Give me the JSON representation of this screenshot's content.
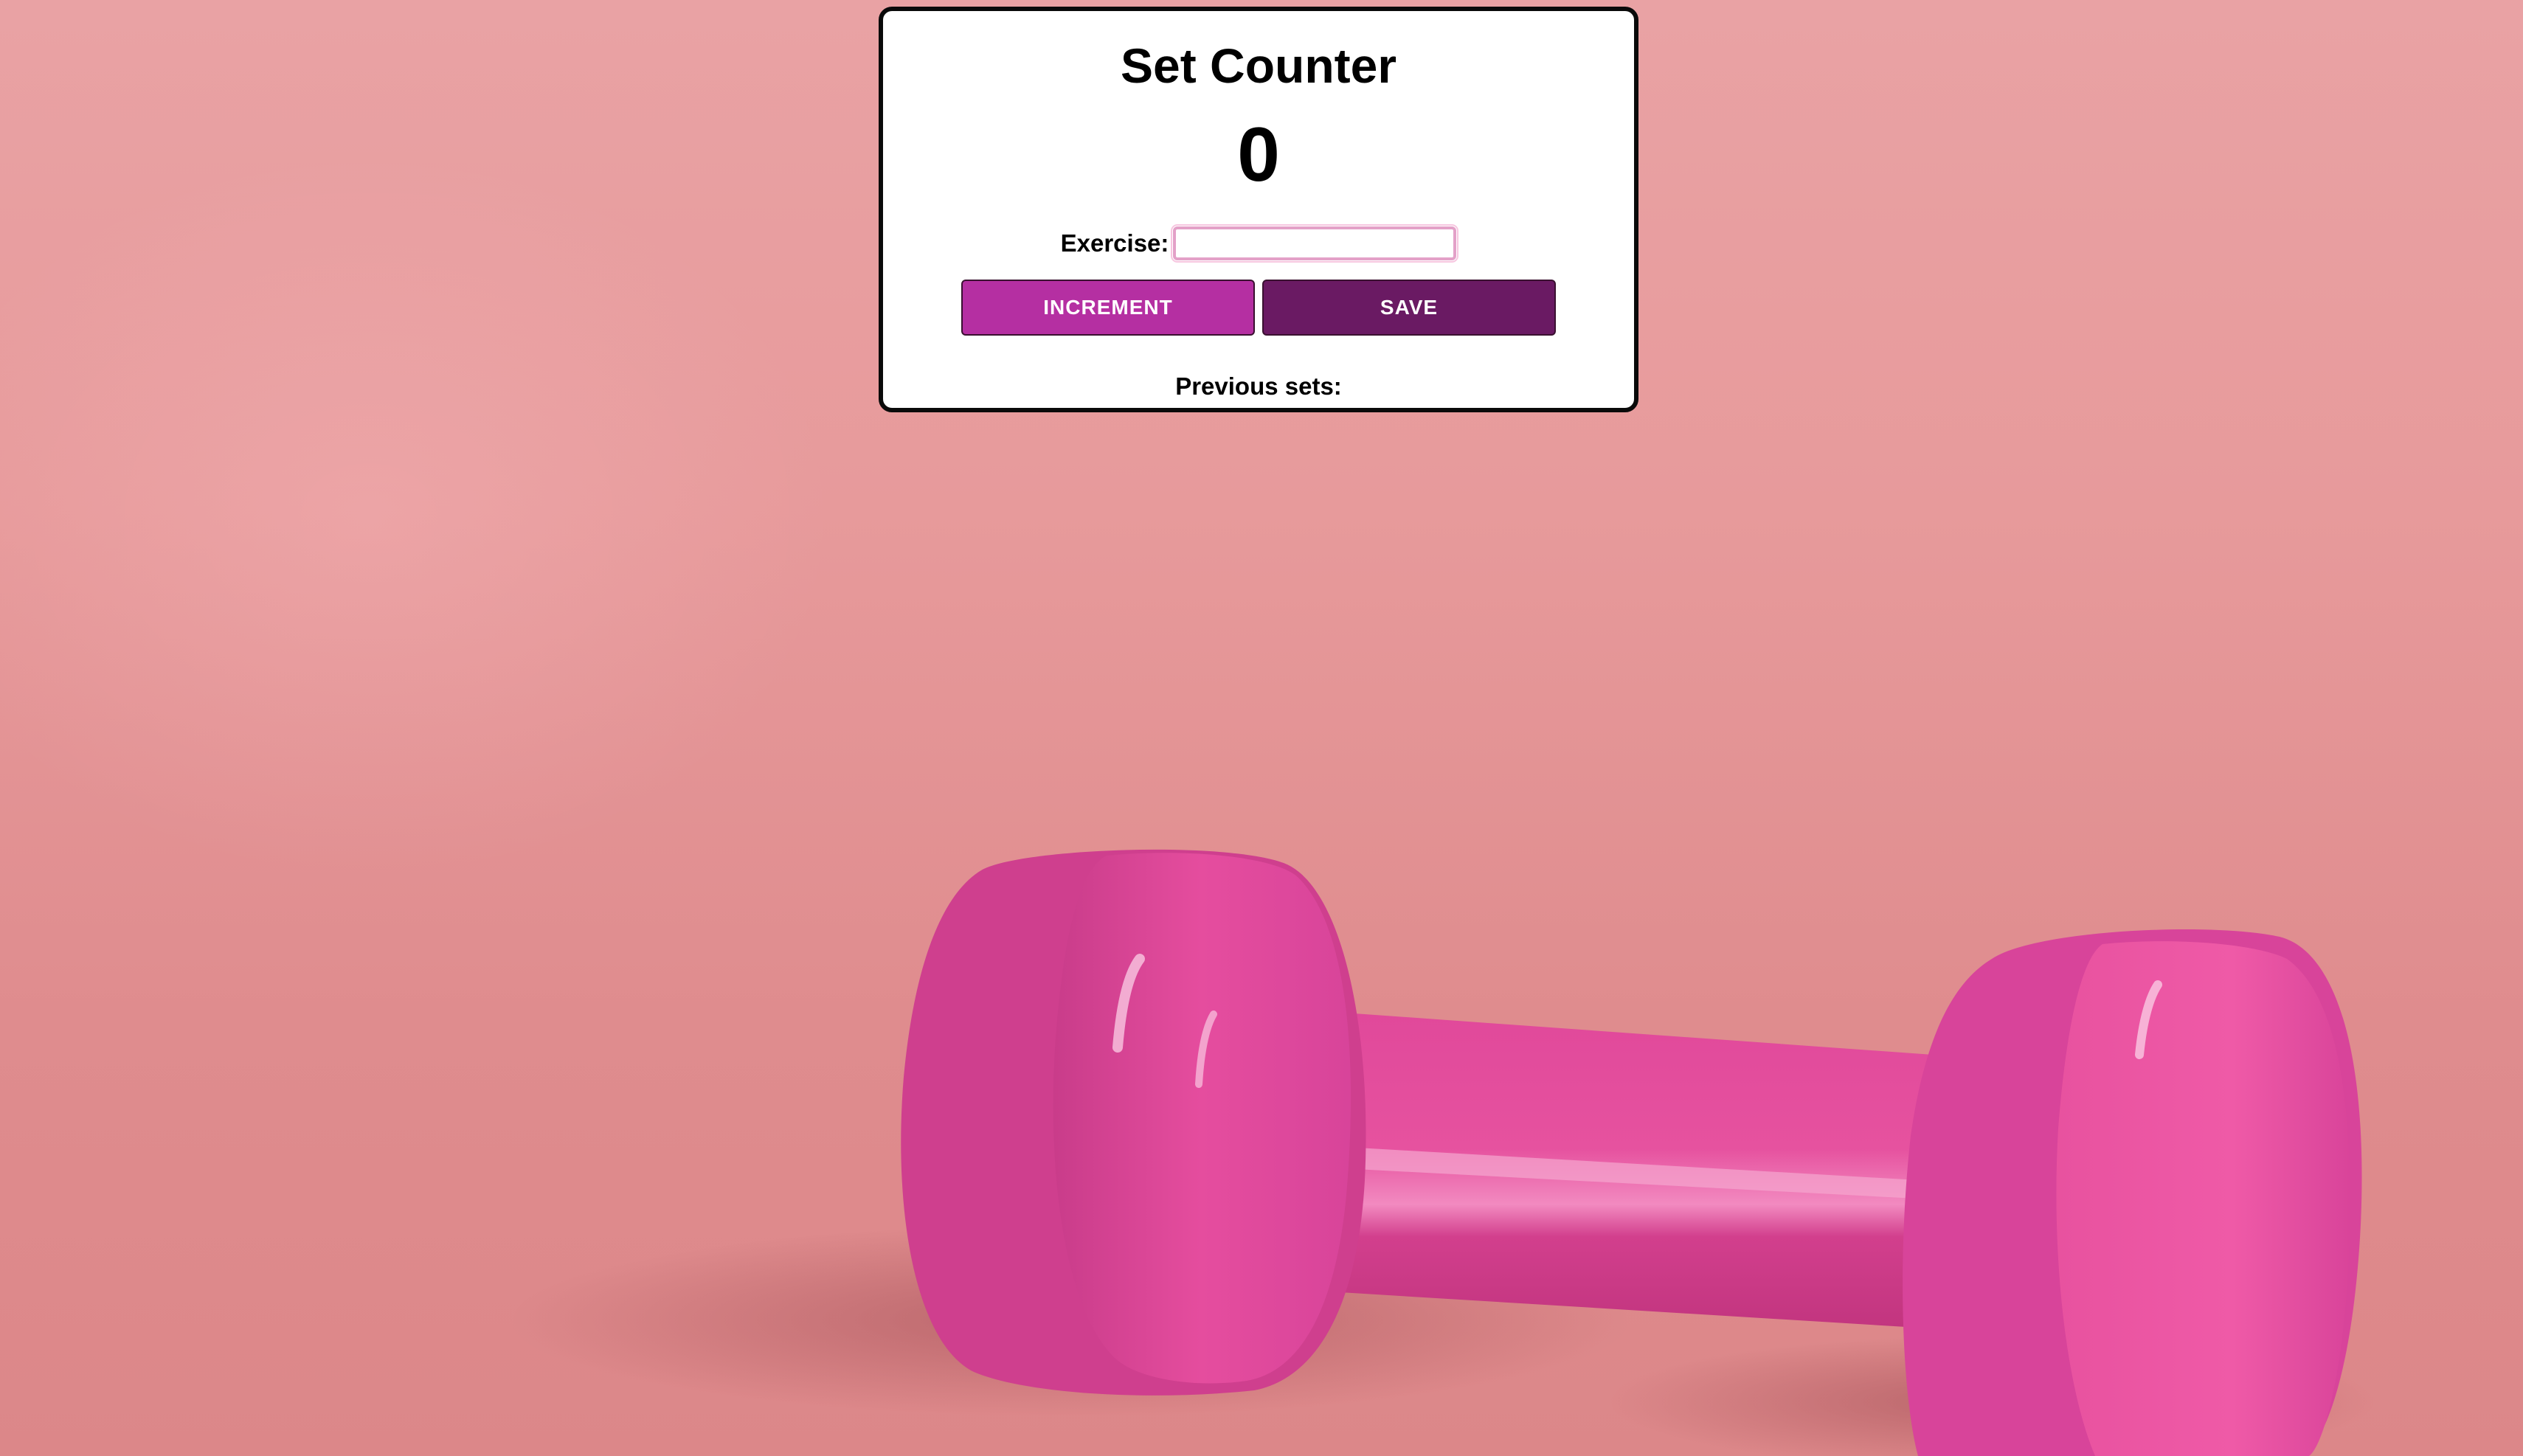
{
  "app": {
    "title": "Set Counter",
    "count": "0"
  },
  "form": {
    "exercise_label": "Exercise:",
    "exercise_value": "",
    "exercise_placeholder": ""
  },
  "buttons": {
    "increment_label": "INCREMENT",
    "save_label": "SAVE"
  },
  "history": {
    "heading": "Previous sets:",
    "items": []
  },
  "colors": {
    "background": "#e79a9b",
    "increment_button": "#b52fa2",
    "save_button": "#6a1a63",
    "dumbbell": "#e2469a",
    "card_border": "#0a0a0a"
  },
  "icons": {
    "background_image": "pink-dumbbell-image"
  }
}
